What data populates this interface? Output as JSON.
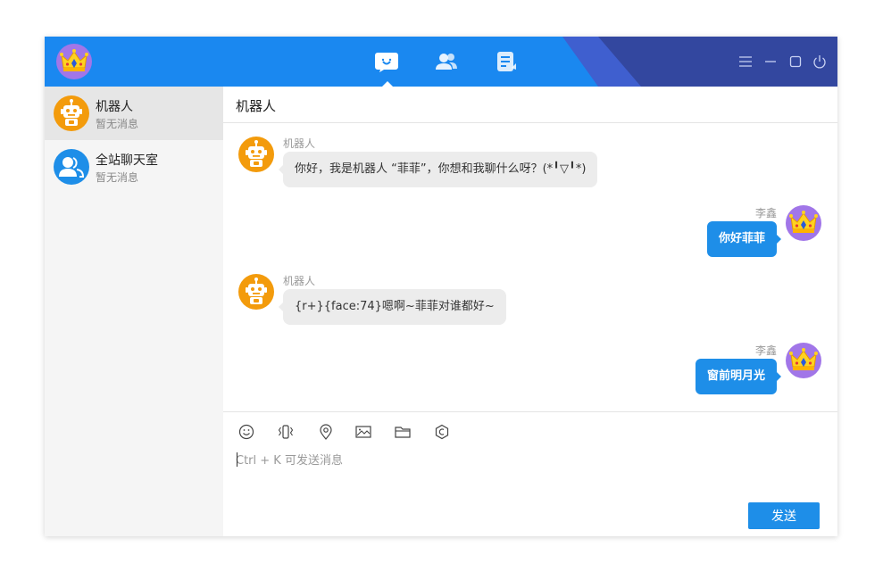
{
  "colors": {
    "accent": "#1a88f0",
    "send_button": "#1e8ee8",
    "bot_avatar": "#f39b0c",
    "user_avatar": "#a176e8",
    "sidebar_bg": "#f5f5f5",
    "bubble_incoming": "#ececec"
  },
  "header": {
    "avatar_icon": "crown-icon",
    "tabs": [
      {
        "icon": "chat-bubble-icon",
        "active": true
      },
      {
        "icon": "contacts-icon",
        "active": false
      },
      {
        "icon": "notes-icon",
        "active": false
      }
    ],
    "controls": [
      "menu-icon",
      "minimize-icon",
      "maximize-icon",
      "power-icon"
    ]
  },
  "sidebar": {
    "items": [
      {
        "name": "机器人",
        "sub": "暂无消息",
        "icon": "robot-icon"
      },
      {
        "name": "全站聊天室",
        "sub": "暂无消息",
        "icon": "group-icon"
      }
    ]
  },
  "chat": {
    "title": "机器人",
    "messages": [
      {
        "from": "机器人",
        "side": "left",
        "text": "你好，我是机器人 “菲菲”，你想和我聊什么呀？(*╹▽╹*)"
      },
      {
        "from": "李鑫",
        "side": "right",
        "text": "你好菲菲"
      },
      {
        "from": "机器人",
        "side": "left",
        "text": "{r+}{face:74}嗯啊~菲菲对谁都好~"
      },
      {
        "from": "李鑫",
        "side": "right",
        "text": "窗前明月光"
      }
    ]
  },
  "composer": {
    "tools": [
      "smiley-icon",
      "shake-icon",
      "location-icon",
      "image-icon",
      "folder-icon",
      "settings-icon"
    ],
    "placeholder": "Ctrl + K 可发送消息",
    "value": "",
    "send_label": "发送"
  }
}
